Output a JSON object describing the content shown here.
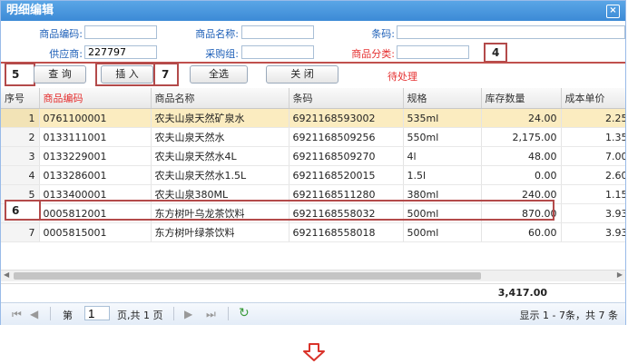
{
  "window": {
    "title": "明细编辑",
    "close_glyph": "×"
  },
  "form": {
    "product_code_label": "商品编码:",
    "product_code_value": "",
    "product_name_label": "商品名称:",
    "product_name_value": "",
    "barcode_label": "条码:",
    "barcode_value": "",
    "supplier_label": "供应商:",
    "supplier_value": "227797",
    "purchase_group_label": "采购组:",
    "purchase_group_value": "",
    "category_label": "商品分类:",
    "category_value": ""
  },
  "toolbar": {
    "query_label": "查 询",
    "insert_label": "插 入",
    "select_all_label": "全选",
    "close_label": "关 闭",
    "status_text": "待处理"
  },
  "markers": {
    "m4": "4",
    "m5": "5",
    "m6": "6",
    "m7": "7"
  },
  "table": {
    "headers": {
      "idx": "序号",
      "code": "商品编码",
      "name": "商品名称",
      "barcode": "条码",
      "spec": "规格",
      "qty": "库存数量",
      "cost": "成本单价"
    },
    "rows": [
      {
        "idx": "1",
        "code": "0761100001",
        "name": "农夫山泉天然矿泉水",
        "barcode": "6921168593002",
        "spec": "535ml",
        "qty": "24.00",
        "cost": "2.25"
      },
      {
        "idx": "2",
        "code": "0133111001",
        "name": "农夫山泉天然水",
        "barcode": "6921168509256",
        "spec": "550ml",
        "qty": "2,175.00",
        "cost": "1.35"
      },
      {
        "idx": "3",
        "code": "0133229001",
        "name": "农夫山泉天然水4L",
        "barcode": "6921168509270",
        "spec": "4l",
        "qty": "48.00",
        "cost": "7.00"
      },
      {
        "idx": "4",
        "code": "0133286001",
        "name": "农夫山泉天然水1.5L",
        "barcode": "6921168520015",
        "spec": "1.5l",
        "qty": "0.00",
        "cost": "2.60"
      },
      {
        "idx": "5",
        "code": "0133400001",
        "name": "农夫山泉380ML",
        "barcode": "6921168511280",
        "spec": "380ml",
        "qty": "240.00",
        "cost": "1.15"
      },
      {
        "idx": "6",
        "code": "0005812001",
        "name": "东方树叶乌龙茶饮料",
        "barcode": "6921168558032",
        "spec": "500ml",
        "qty": "870.00",
        "cost": "3.93"
      },
      {
        "idx": "7",
        "code": "0005815001",
        "name": "东方树叶绿茶饮料",
        "barcode": "6921168558018",
        "spec": "500ml",
        "qty": "60.00",
        "cost": "3.93"
      }
    ],
    "total_qty": "3,417.00"
  },
  "pager": {
    "page_prefix": "第",
    "page_value": "1",
    "page_suffix": "页,共 1 页",
    "summary": "显示 1 - 7条，共 7 条"
  },
  "icons": {
    "first": "first-page-icon",
    "prev": "prev-page-icon",
    "next": "next-page-icon",
    "last": "last-page-icon",
    "refresh": "refresh-icon",
    "down": "down-arrow-icon"
  },
  "colors": {
    "title_bar": "#3c8ad6",
    "selected_row": "#fbecc0",
    "required_label": "#e53030",
    "marker_border": "#b34a4a"
  }
}
